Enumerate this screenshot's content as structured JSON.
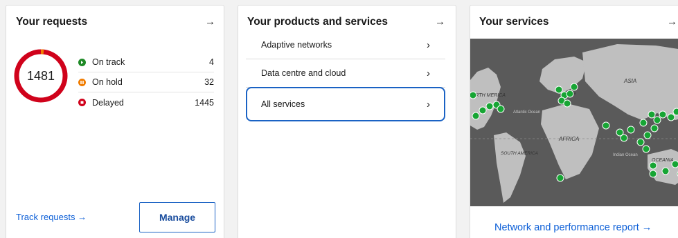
{
  "requests": {
    "title": "Your requests",
    "arrow": "→",
    "total": "1481",
    "statuses": [
      {
        "label": "On track",
        "count": "4",
        "color": "#1f8a27"
      },
      {
        "label": "On hold",
        "count": "32",
        "color": "#f07c00"
      },
      {
        "label": "Delayed",
        "count": "1445",
        "color": "#d0021b"
      }
    ],
    "track_link": "Track requests →",
    "manage_label": "Manage"
  },
  "products": {
    "title": "Your products and services",
    "arrow": "→",
    "items": [
      {
        "label": "Adaptive networks",
        "chevron": "›"
      },
      {
        "label": "Data centre and cloud",
        "chevron": "›"
      },
      {
        "label": "All services",
        "chevron": "›",
        "selected": true
      }
    ]
  },
  "services": {
    "title": "Your services",
    "arrow": "→",
    "map_labels": {
      "north_america": "ORTH MERICA",
      "europe": "OPE",
      "asia": "ASIA",
      "atlantic": "Atlantic Ocean",
      "africa": "AFRICA",
      "south_america": "SOUTH AMERICA",
      "indian": "Indian Ocean",
      "oceania": "OCEANIA"
    },
    "report_link": "Network and performance report →"
  },
  "colors": {
    "accent": "#0b5ed7",
    "on_track": "#1f8a27",
    "on_hold": "#f07c00",
    "delayed": "#d0021b",
    "map_pin": "#17a534"
  }
}
